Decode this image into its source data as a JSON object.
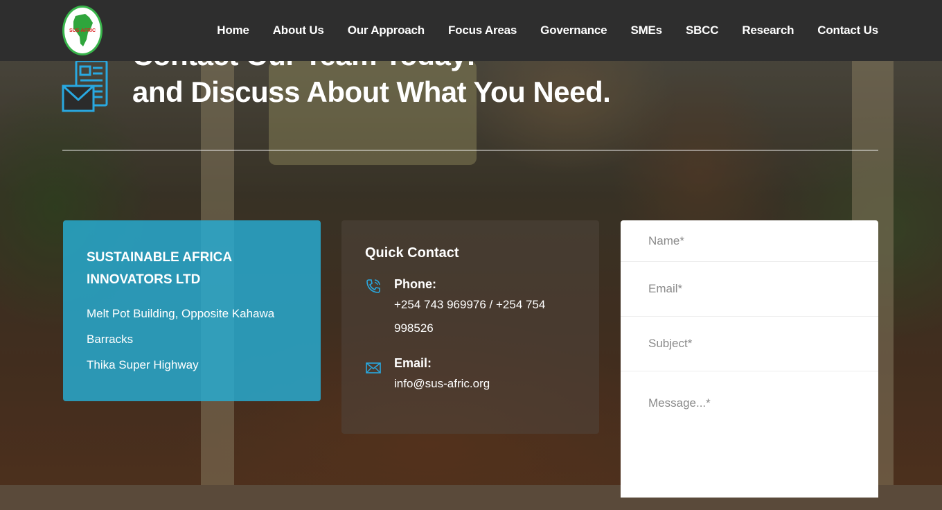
{
  "brand": {
    "logo_text": "SUS-AFRIC",
    "logo_color": "#38b34a"
  },
  "nav": {
    "items": [
      {
        "label": "Home"
      },
      {
        "label": "About Us"
      },
      {
        "label": "Our Approach"
      },
      {
        "label": "Focus Areas"
      },
      {
        "label": "Governance"
      },
      {
        "label": "SMEs"
      },
      {
        "label": "SBCC"
      },
      {
        "label": "Research"
      },
      {
        "label": "Contact Us"
      }
    ]
  },
  "hero": {
    "line1": "Contact Our Team Today!",
    "line2": "and Discuss About What You Need.",
    "icon": "contact-document-mail-icon"
  },
  "company": {
    "name": "SUSTAINABLE AFRICA INNOVATORS LTD",
    "address_line1": "Melt Pot Building, Opposite Kahawa Barracks",
    "address_line2": "Thika Super Highway",
    "color": "#27aed6"
  },
  "quick_contact": {
    "title": "Quick Contact",
    "phone_label": "Phone:",
    "phone_value": "+254 743 969976 / +254 754 998526",
    "phone_icon": "phone-icon",
    "email_label": "Email:",
    "email_value": "info@sus-afric.org",
    "email_icon": "envelope-icon"
  },
  "form": {
    "name_placeholder": "Name*",
    "email_placeholder": "Email*",
    "subject_placeholder": "Subject*",
    "message_placeholder": "Message...*"
  }
}
